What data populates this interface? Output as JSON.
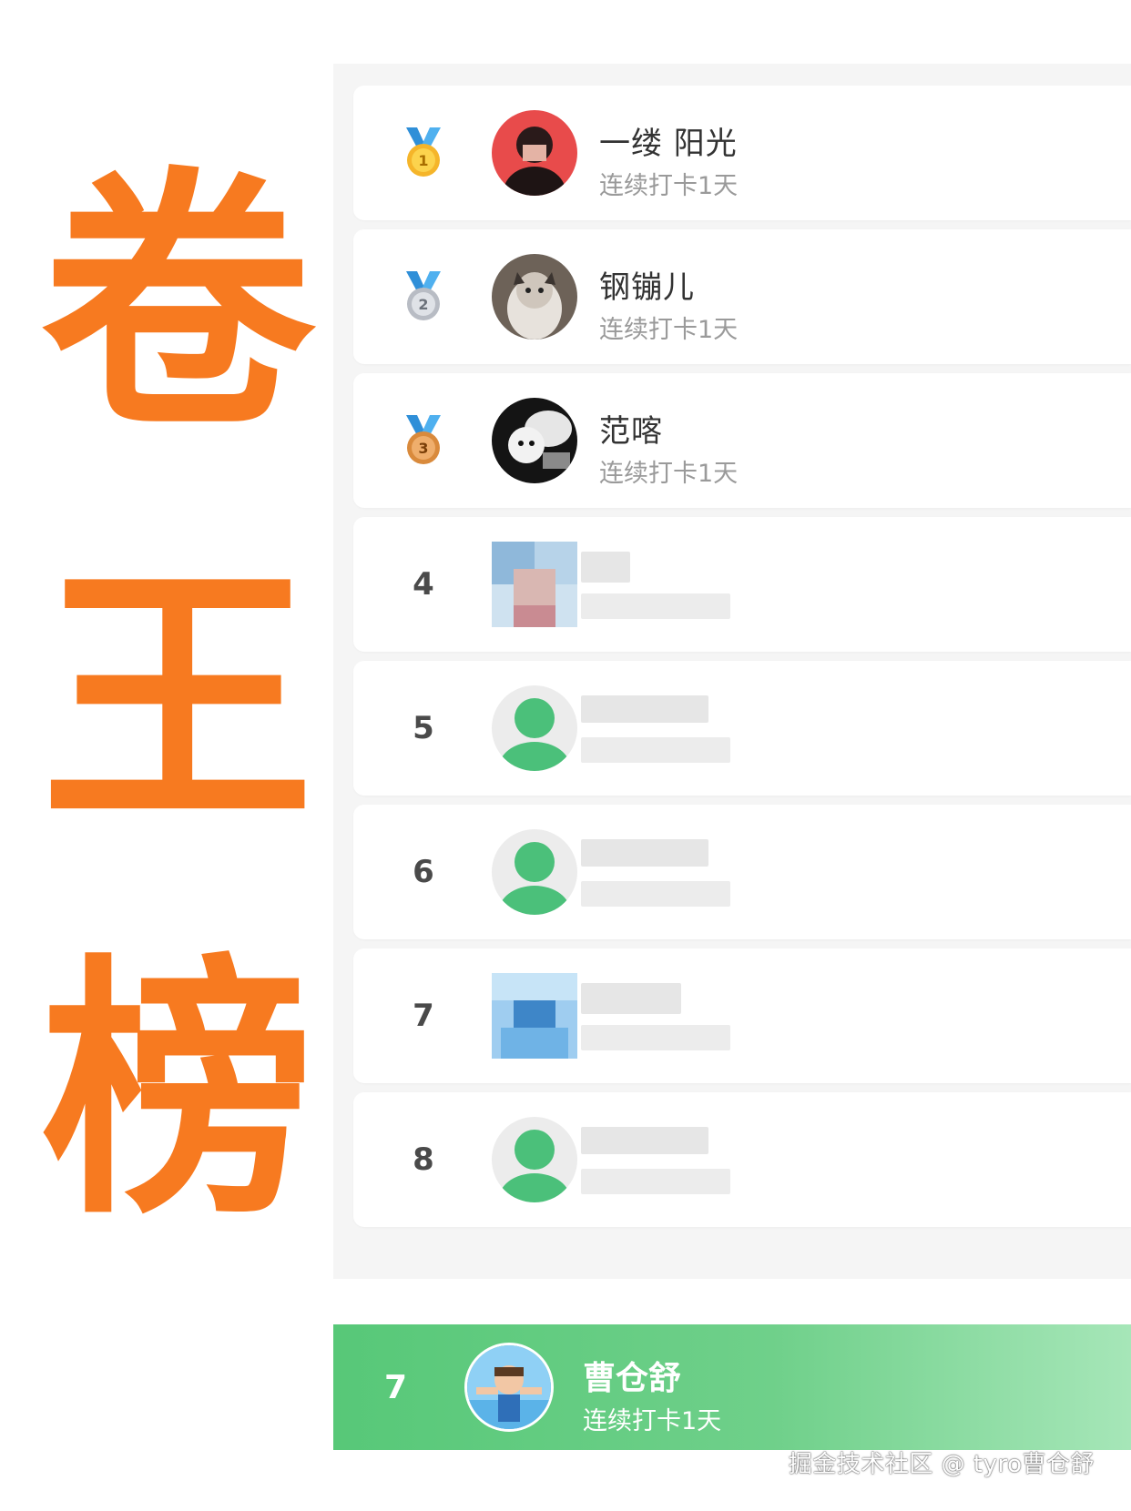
{
  "title": {
    "line1": "卷",
    "line2": "王",
    "line3": "榜"
  },
  "leaderboard": {
    "rows": [
      {
        "rank": "1",
        "medal": "gold-medal-icon",
        "name": "一缕 阳光",
        "sub": "连续打卡1天"
      },
      {
        "rank": "2",
        "medal": "silver-medal-icon",
        "name": "钢镚儿",
        "sub": "连续打卡1天"
      },
      {
        "rank": "3",
        "medal": "bronze-medal-icon",
        "name": "范喀",
        "sub": "连续打卡1天"
      },
      {
        "rank": "4"
      },
      {
        "rank": "5"
      },
      {
        "rank": "6"
      },
      {
        "rank": "7"
      },
      {
        "rank": "8"
      }
    ]
  },
  "self": {
    "rank": "7",
    "name": "曹仓舒",
    "sub": "连续打卡1天"
  },
  "watermark": "掘金技术社区 @ tyro曹仓舒",
  "colors": {
    "accent": "#f77a20",
    "green": "#57c878",
    "panel": "#f5f5f5"
  }
}
